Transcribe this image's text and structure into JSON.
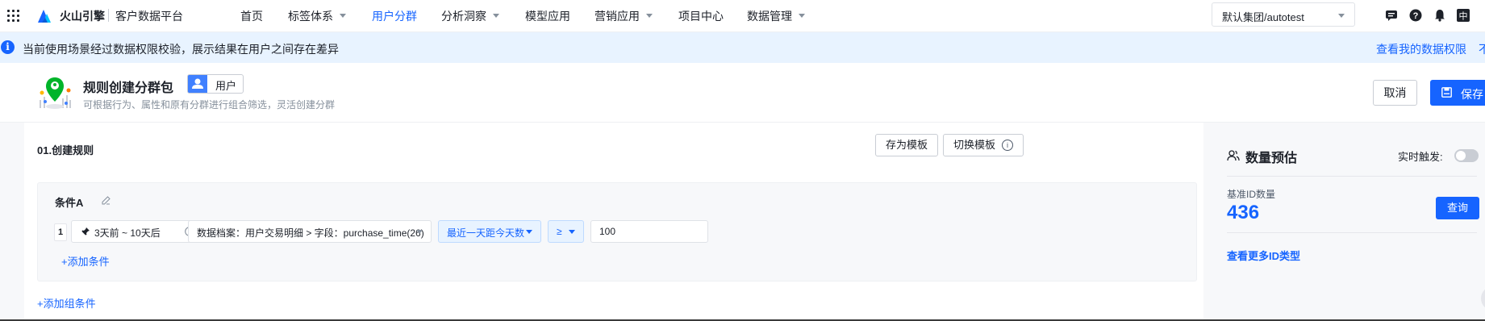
{
  "header": {
    "brand": "火山引擎",
    "product": "客户数据平台",
    "nav": [
      {
        "label": "首页",
        "dropdown": false,
        "active": false
      },
      {
        "label": "标签体系",
        "dropdown": true,
        "active": false
      },
      {
        "label": "用户分群",
        "dropdown": false,
        "active": true
      },
      {
        "label": "分析洞察",
        "dropdown": true,
        "active": false
      },
      {
        "label": "模型应用",
        "dropdown": false,
        "active": false
      },
      {
        "label": "营销应用",
        "dropdown": true,
        "active": false
      },
      {
        "label": "项目中心",
        "dropdown": false,
        "active": false
      },
      {
        "label": "数据管理",
        "dropdown": true,
        "active": false
      }
    ],
    "org_select": "默认集团/autotest",
    "icons": [
      "message-icon",
      "help-icon",
      "bell-icon",
      "language-icon"
    ],
    "language_label": "中"
  },
  "notice": {
    "text": "当前使用场景经过数据权限校验，展示结果在用户之间存在差异",
    "link": "查看我的数据权限",
    "extra": "不"
  },
  "page": {
    "title": "规则创建分群包",
    "entity": "用户",
    "subtitle": "可根据行为、属性和原有分群进行组合筛选，灵活创建分群",
    "cancel": "取消",
    "save": "保存"
  },
  "rules": {
    "section_title": "01.创建规则",
    "save_template": "存为模板",
    "switch_template": "切换模板",
    "condition_group": {
      "title": "条件A",
      "rows": [
        {
          "index": "1",
          "time_range": "3天前 ~ 10天后",
          "source": "数据档案：用户交易明细 > 字段：purchase_time(26)",
          "metric": "最近一天距今天数",
          "operator": "≥",
          "value": "100"
        }
      ],
      "add_condition": "+添加条件"
    },
    "add_group": "+添加组条件"
  },
  "preview": {
    "title": "数量预估",
    "realtime_label": "实时触发:",
    "realtime_on": false,
    "base_label": "基准ID数量",
    "base_count": "436",
    "query": "查询",
    "more_ids": "查看更多ID类型"
  },
  "colors": {
    "primary": "#1664ff",
    "notice_bg": "#e8f3ff",
    "page_bg": "#f7f8fa"
  }
}
